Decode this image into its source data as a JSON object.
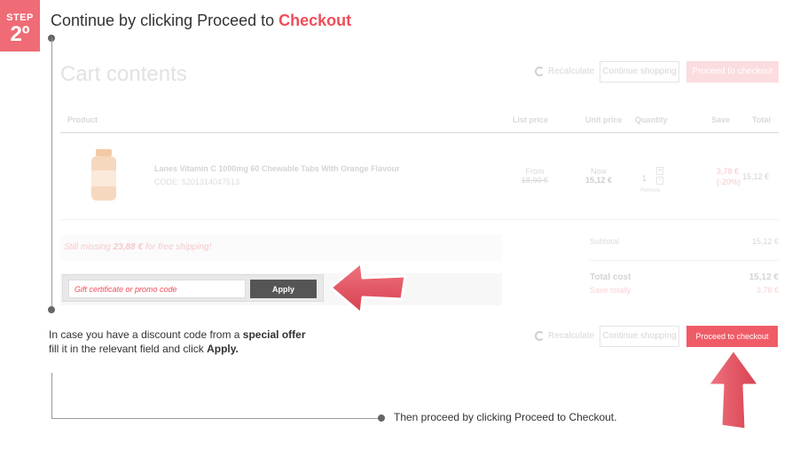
{
  "step": {
    "word": "STEP",
    "number": "2º",
    "title_prefix": "Continue by clicking Proceed to ",
    "title_highlight": "Checkout"
  },
  "cart": {
    "title": "Cart contents",
    "recalculate_label": "Recalculate",
    "continue_label": "Continue shopping",
    "checkout_label": "Proceed to checkout",
    "columns": [
      "Product",
      "List price",
      "Unit price",
      "Quantity",
      "Save",
      "Total"
    ],
    "item": {
      "name": "Lanes Vitamin C 1000mg 60 Chewable Tabs With Orange Flavour",
      "code": "CODE: 5201314047513",
      "list_from": "From",
      "list_price": "18,90 €",
      "unit_now": "Now",
      "unit_price": "15,12 €",
      "quantity": "1",
      "plus": "+",
      "minus": "-",
      "remove": "Remove",
      "save_amount": "3,78 €",
      "save_percent": "(-20%)",
      "total": "15,12 €"
    },
    "shipping_prefix": "Still missing ",
    "shipping_amount": "23,88 €",
    "shipping_suffix": " for free shipping!",
    "promo_placeholder": "Gift certificate or promo code",
    "apply_label": "Apply",
    "subtotal_label": "Subtotal",
    "subtotal_value": "15,12 €",
    "total_label": "Total cost",
    "total_value": "15,12 €",
    "saved_label": "Save totally",
    "saved_value": "3,78 €"
  },
  "notes": {
    "discount_line1_prefix": "In case you have a discount code from a ",
    "discount_line1_bold": "special offer",
    "discount_line2_prefix": "fill it in the relevant field and click ",
    "discount_line2_bold": "Apply.",
    "proceed": "Then proceed by clicking Proceed to Checkout."
  },
  "colors": {
    "accent": "#ef5c67",
    "badge": "#ef6b75",
    "arrow": "#e8515e"
  }
}
